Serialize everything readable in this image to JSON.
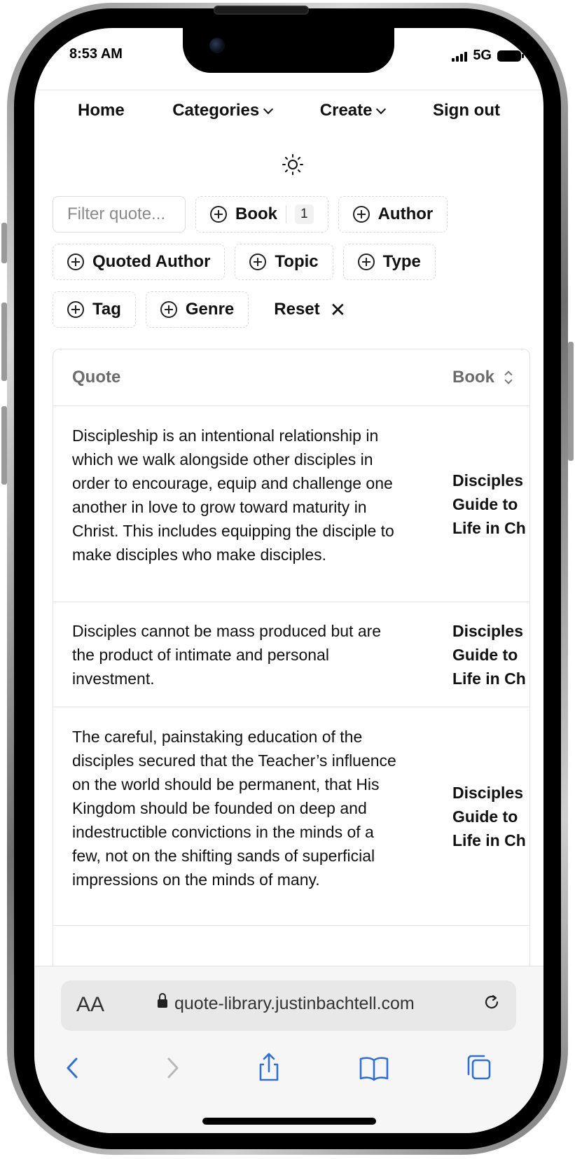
{
  "status": {
    "time": "8:53 AM",
    "network": "5G"
  },
  "nav": {
    "home": "Home",
    "categories": "Categories",
    "create": "Create",
    "signout": "Sign out"
  },
  "filters": {
    "placeholder": "Filter quote...",
    "book": "Book",
    "book_count": "1",
    "author": "Author",
    "quoted_author": "Quoted Author",
    "topic": "Topic",
    "type": "Type",
    "tag": "Tag",
    "genre": "Genre",
    "reset": "Reset"
  },
  "table": {
    "headers": {
      "quote": "Quote",
      "book": "Book"
    },
    "rows": [
      {
        "quote": "Discipleship is an intentional relationship in which we walk alongside other disciples in order to encourage, equip and challenge one another in love to grow toward maturity in Christ. This includes equipping the disciple to make disciples who make disciples.",
        "book": "Disciples\nGuide to\nLife in Ch"
      },
      {
        "quote": "Disciples cannot be mass produced but are the product of intimate and personal investment.",
        "book": "Disciples\nGuide to\nLife in Ch"
      },
      {
        "quote": "The careful, painstaking education of the disciples secured that the Teacher’s influence on the world should be permanent, that His Kingdom should be founded on deep and indestructible convictions in the minds of a few, not on the shifting sands of superficial impressions on the minds of many.",
        "book": "Disciples\nGuide to\nLife in Ch"
      }
    ]
  },
  "safari": {
    "aa": "AA",
    "url": "quote-library.justinbachtell.com"
  },
  "colors": {
    "safari_blue": "#2f6fd6",
    "muted": "#6b6b6b"
  }
}
